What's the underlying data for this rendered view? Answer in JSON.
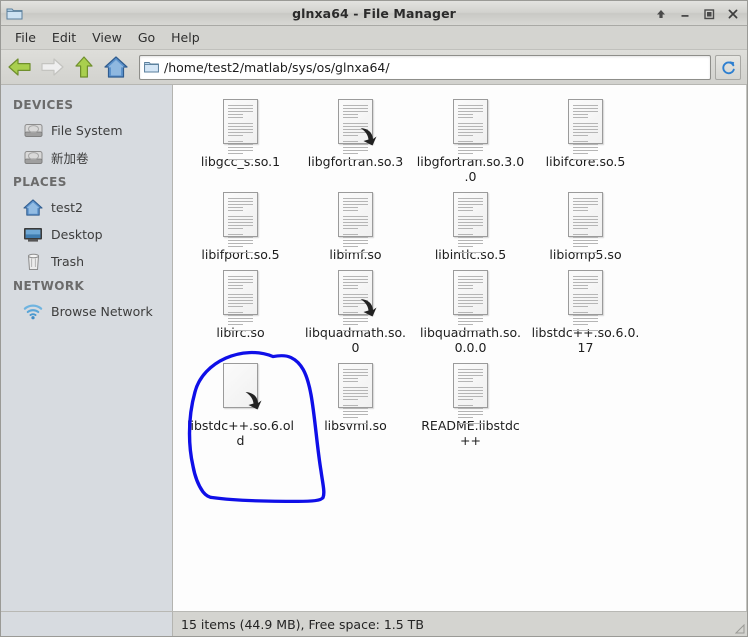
{
  "window": {
    "title": "glnxa64 - File Manager",
    "icon": "folder-icon",
    "controls": [
      {
        "name": "shade-button",
        "glyph": "shade-up-icon"
      },
      {
        "name": "minimize-button",
        "glyph": "minimize-icon"
      },
      {
        "name": "maximize-button",
        "glyph": "maximize-icon"
      },
      {
        "name": "close-button",
        "glyph": "close-icon"
      }
    ]
  },
  "menubar": {
    "items": [
      {
        "label": "File"
      },
      {
        "label": "Edit"
      },
      {
        "label": "View"
      },
      {
        "label": "Go"
      },
      {
        "label": "Help"
      }
    ]
  },
  "toolbar": {
    "back": {
      "name": "back-button",
      "icon": "arrow-left-icon",
      "enabled": true
    },
    "forward": {
      "name": "forward-button",
      "icon": "arrow-right-icon",
      "enabled": false
    },
    "up": {
      "name": "up-button",
      "icon": "arrow-up-icon",
      "enabled": true
    },
    "home": {
      "name": "home-button",
      "icon": "home-icon",
      "enabled": true
    },
    "path_value": "/home/test2/matlab/sys/os/glnxa64/",
    "path_placeholder": "Location",
    "reload": {
      "name": "reload-button",
      "icon": "refresh-icon"
    }
  },
  "sidebar": {
    "groups": [
      {
        "header": "DEVICES",
        "items": [
          {
            "label": "File System",
            "icon": "drive-icon"
          },
          {
            "label": "新加卷",
            "icon": "drive-icon"
          }
        ]
      },
      {
        "header": "PLACES",
        "items": [
          {
            "label": "test2",
            "icon": "home-icon"
          },
          {
            "label": "Desktop",
            "icon": "desktop-icon"
          },
          {
            "label": "Trash",
            "icon": "trash-icon"
          }
        ]
      },
      {
        "header": "NETWORK",
        "items": [
          {
            "label": "Browse Network",
            "icon": "network-icon"
          }
        ]
      }
    ]
  },
  "files": [
    {
      "name": "libgcc_s.so.1",
      "icon": "text-file-icon",
      "symlink": false
    },
    {
      "name": "libgfortran.so.3",
      "icon": "text-file-icon",
      "symlink": true
    },
    {
      "name": "libgfortran.so.3.0.0",
      "icon": "text-file-icon",
      "symlink": false
    },
    {
      "name": "libifcore.so.5",
      "icon": "text-file-icon",
      "symlink": false
    },
    {
      "name": "libifport.so.5",
      "icon": "text-file-icon",
      "symlink": false
    },
    {
      "name": "libimf.so",
      "icon": "text-file-icon",
      "symlink": false
    },
    {
      "name": "libintlc.so.5",
      "icon": "text-file-icon",
      "symlink": false
    },
    {
      "name": "libiomp5.so",
      "icon": "text-file-icon",
      "symlink": false
    },
    {
      "name": "libirc.so",
      "icon": "text-file-icon",
      "symlink": false
    },
    {
      "name": "libquadmath.so.0",
      "icon": "text-file-icon",
      "symlink": true
    },
    {
      "name": "libquadmath.so.0.0.0",
      "icon": "text-file-icon",
      "symlink": false
    },
    {
      "name": "libstdc++.so.6.0.17",
      "icon": "text-file-icon",
      "symlink": false
    },
    {
      "name": "libstdc++.so.6.old",
      "icon": "blank-file-icon",
      "symlink": true
    },
    {
      "name": "libsvml.so",
      "icon": "text-file-icon",
      "symlink": false
    },
    {
      "name": "README.libstdc++",
      "icon": "text-file-icon",
      "symlink": false
    }
  ],
  "annotation": {
    "shape": "hand-drawn-circle",
    "color": "#0f0fe8",
    "targets": "libstdc++.so.6.old"
  },
  "statusbar": {
    "text": "15 items (44.9 MB), Free space: 1.5 TB"
  },
  "colors": {
    "sidebar_bg": "#d7dbe0",
    "chrome_bg": "#d4d4d0",
    "pane_bg": "#fdfdfd",
    "annotation": "#0f0fe8"
  }
}
